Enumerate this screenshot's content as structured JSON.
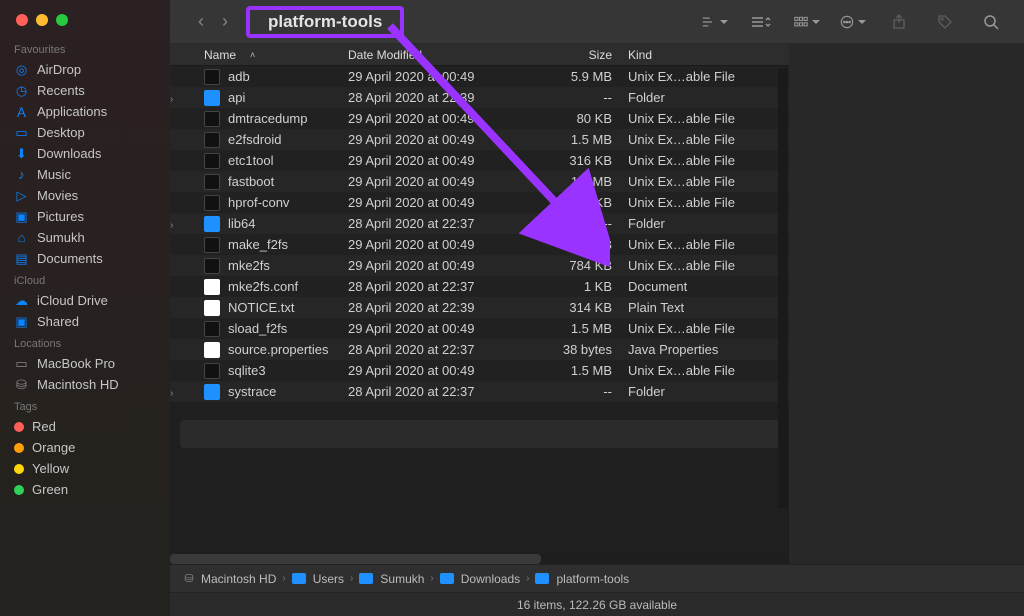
{
  "window": {
    "title": "platform-tools"
  },
  "toolbar": {
    "back": "‹",
    "forward": "›",
    "icons": [
      "view-hierarchy",
      "view-list",
      "view-grid",
      "action-circle",
      "share",
      "tag",
      "search"
    ]
  },
  "sidebar": {
    "favourites_label": "Favourites",
    "favourites": [
      {
        "icon": "airdrop",
        "label": "AirDrop"
      },
      {
        "icon": "clock",
        "label": "Recents"
      },
      {
        "icon": "apps",
        "label": "Applications"
      },
      {
        "icon": "desktop",
        "label": "Desktop"
      },
      {
        "icon": "downloads",
        "label": "Downloads"
      },
      {
        "icon": "music",
        "label": "Music"
      },
      {
        "icon": "movies",
        "label": "Movies"
      },
      {
        "icon": "pictures",
        "label": "Pictures"
      },
      {
        "icon": "home",
        "label": "Sumukh"
      },
      {
        "icon": "documents",
        "label": "Documents"
      }
    ],
    "icloud_label": "iCloud",
    "icloud": [
      {
        "icon": "icloud",
        "label": "iCloud Drive"
      },
      {
        "icon": "shared",
        "label": "Shared"
      }
    ],
    "locations_label": "Locations",
    "locations": [
      {
        "icon": "laptop",
        "label": "MacBook Pro"
      },
      {
        "icon": "hdd",
        "label": "Macintosh HD"
      }
    ],
    "tags_label": "Tags",
    "tags": [
      {
        "color": "#ff5f57",
        "label": "Red"
      },
      {
        "color": "#ff9f0a",
        "label": "Orange"
      },
      {
        "color": "#ffd60a",
        "label": "Yellow"
      },
      {
        "color": "#30d158",
        "label": "Green"
      }
    ]
  },
  "columns": {
    "name": "Name",
    "date": "Date Modified",
    "size": "Size",
    "kind": "Kind"
  },
  "files": [
    {
      "chev": "",
      "type": "exec",
      "name": "adb",
      "date": "29 April 2020 at 00:49",
      "size": "5.9 MB",
      "kind": "Unix Ex…able File"
    },
    {
      "chev": "›",
      "type": "folder",
      "name": "api",
      "date": "28 April 2020 at 22:39",
      "size": "--",
      "kind": "Folder"
    },
    {
      "chev": "",
      "type": "exec",
      "name": "dmtracedump",
      "date": "29 April 2020 at 00:49",
      "size": "80 KB",
      "kind": "Unix Ex…able File"
    },
    {
      "chev": "",
      "type": "exec",
      "name": "e2fsdroid",
      "date": "29 April 2020 at 00:49",
      "size": "1.5 MB",
      "kind": "Unix Ex…able File"
    },
    {
      "chev": "",
      "type": "exec",
      "name": "etc1tool",
      "date": "29 April 2020 at 00:49",
      "size": "316 KB",
      "kind": "Unix Ex…able File"
    },
    {
      "chev": "",
      "type": "exec",
      "name": "fastboot",
      "date": "29 April 2020 at 00:49",
      "size": "1.7 MB",
      "kind": "Unix Ex…able File"
    },
    {
      "chev": "",
      "type": "exec",
      "name": "hprof-conv",
      "date": "29 April 2020 at 00:49",
      "size": "36 KB",
      "kind": "Unix Ex…able File"
    },
    {
      "chev": "›",
      "type": "folder",
      "name": "lib64",
      "date": "28 April 2020 at 22:37",
      "size": "--",
      "kind": "Folder"
    },
    {
      "chev": "",
      "type": "exec",
      "name": "make_f2fs",
      "date": "29 April 2020 at 00:49",
      "size": "257 KB",
      "kind": "Unix Ex…able File"
    },
    {
      "chev": "",
      "type": "exec",
      "name": "mke2fs",
      "date": "29 April 2020 at 00:49",
      "size": "784 KB",
      "kind": "Unix Ex…able File"
    },
    {
      "chev": "",
      "type": "doc",
      "name": "mke2fs.conf",
      "date": "28 April 2020 at 22:37",
      "size": "1 KB",
      "kind": "Document"
    },
    {
      "chev": "",
      "type": "doc",
      "name": "NOTICE.txt",
      "date": "28 April 2020 at 22:39",
      "size": "314 KB",
      "kind": "Plain Text"
    },
    {
      "chev": "",
      "type": "exec",
      "name": "sload_f2fs",
      "date": "29 April 2020 at 00:49",
      "size": "1.5 MB",
      "kind": "Unix Ex…able File"
    },
    {
      "chev": "",
      "type": "doc",
      "name": "source.properties",
      "date": "28 April 2020 at 22:37",
      "size": "38 bytes",
      "kind": "Java Properties"
    },
    {
      "chev": "",
      "type": "exec",
      "name": "sqlite3",
      "date": "29 April 2020 at 00:49",
      "size": "1.5 MB",
      "kind": "Unix Ex…able File"
    },
    {
      "chev": "›",
      "type": "folder",
      "name": "systrace",
      "date": "28 April 2020 at 22:37",
      "size": "--",
      "kind": "Folder"
    }
  ],
  "path": [
    {
      "icon": "hdd",
      "label": "Macintosh HD"
    },
    {
      "icon": "folder",
      "label": "Users"
    },
    {
      "icon": "folder",
      "label": "Sumukh"
    },
    {
      "icon": "folder",
      "label": "Downloads"
    },
    {
      "icon": "folder",
      "label": "platform-tools"
    }
  ],
  "status": "16 items, 122.26 GB available"
}
